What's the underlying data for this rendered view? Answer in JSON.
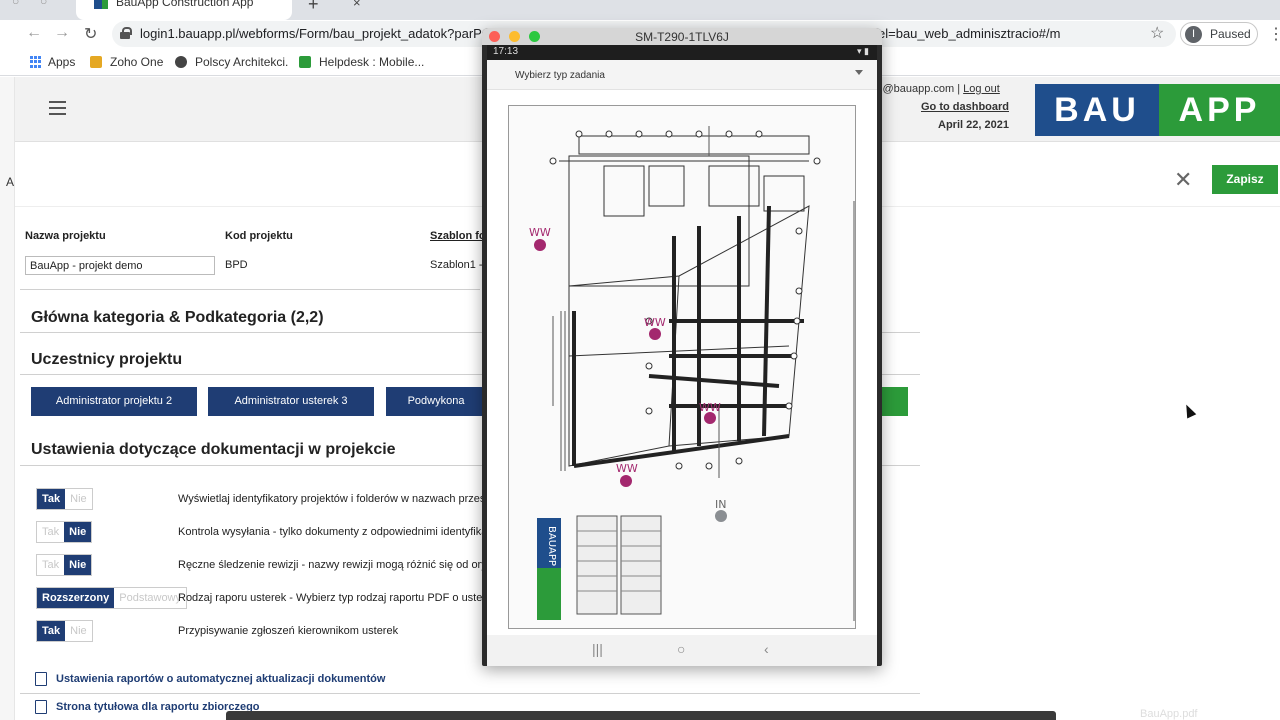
{
  "browser": {
    "tab_title": "BauApp Construction App",
    "tab_close": "×",
    "new_tab": "+",
    "ghost_tab_icons": [
      "○",
      "○"
    ],
    "url_visible": "login1.bauapp.pl/webforms/Form/bau_projekt_adatok?parP",
    "url_tail": "el=bau_web_adminisztracio#/m",
    "profile_initial": "I",
    "profile_status": "Paused",
    "bookmarks": [
      "Apps",
      "Zoho One",
      "Polscy Architekci.",
      "Helpdesk : Mobile..."
    ]
  },
  "header": {
    "user_email": "l@bauapp.com",
    "separator": " | ",
    "logout": "Log out",
    "dashboard": "Go to dashboard",
    "date": "April 22, 2021",
    "logo_left": "BAU",
    "logo_right": "APP"
  },
  "actions": {
    "save": "Zapisz",
    "close": "✕"
  },
  "left_strip_char": "A",
  "project": {
    "name_label": "Nazwa projektu",
    "code_label": "Kod projektu",
    "template_label": "Szablon fo",
    "name_value": "BauApp - projekt demo",
    "code_value": "BPD",
    "template_value": "Szablon1 -"
  },
  "sections": {
    "categories": "Główna kategoria & Podkategoria (2,2)",
    "participants": "Uczestnicy projektu",
    "documentation": "Ustawienia dotyczące dokumentacji w projekcie"
  },
  "roles": [
    "Administrator projektu 2",
    "Administrator usterek 3",
    "Podwykona"
  ],
  "settings": [
    {
      "on": "Tak",
      "off": "Nie",
      "active": "on",
      "text": "Wyświetlaj identyfikatory projektów i folderów w nazwach przesy"
    },
    {
      "on": "Tak",
      "off": "Nie",
      "active": "off",
      "text": "Kontrola wysyłania - tylko dokumenty z odpowiednimi identyfikat"
    },
    {
      "on": "Tak",
      "off": "Nie",
      "active": "off",
      "text": "Ręczne śledzenie rewizji - nazwy rewizji mogą różnić się od oryg"
    },
    {
      "on": "Rozszerzony",
      "off": "Podstawowy",
      "active": "on",
      "text": "Rodzaj raporu usterek - Wybierz typ rodzaj raportu PDF o usterk"
    },
    {
      "on": "Tak",
      "off": "Nie",
      "active": "on",
      "text": "Przypisywanie zgłoszeń kierownikom usterek"
    }
  ],
  "doc_links": [
    "Ustawienia raportów o automatycznej aktualizacji dokumentów",
    "Strona tytułowa dla raportu zbiorczego"
  ],
  "device": {
    "window_title": "SM-T290-1TLV6J",
    "time": "17:13",
    "status_icons": "▾ ▮",
    "dropdown_label": "Wybierz typ zadania",
    "plan_markers": [
      "WW",
      "WW",
      "WW",
      "WW",
      "IN"
    ],
    "plan_logo_text": "BAUAPP",
    "nav_recent": "|||",
    "nav_home": "○",
    "nav_back": "‹"
  },
  "dock_label": "BauApp.pdf",
  "colors": {
    "navy": "#1f3d74",
    "brand_blue": "#1f4e8c",
    "brand_green": "#2c9b3a",
    "marker": "#a3286e"
  }
}
